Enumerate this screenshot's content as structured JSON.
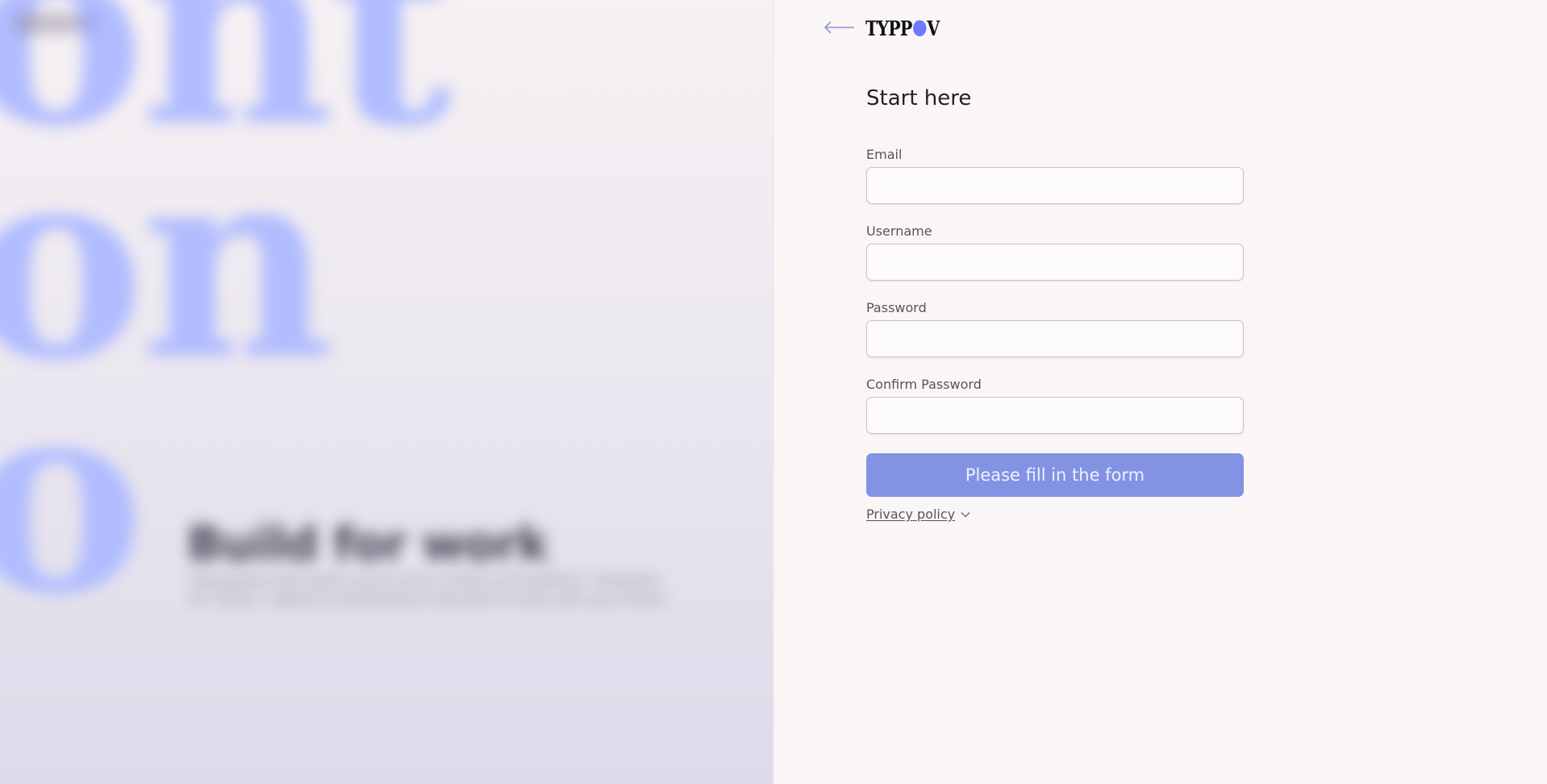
{
  "background_panel": {
    "big_glyphs": "ont\non\no",
    "heading": "Build for work",
    "body": "Typography that works across every surface and platform. Designed for clarity, crafted for performance and built to scale with your brand."
  },
  "header": {
    "back_icon": "arrow-left-icon",
    "brand_prefix": "TYPP",
    "brand_suffix": "V"
  },
  "form": {
    "title": "Start here",
    "fields": [
      {
        "label": "Email",
        "value": ""
      },
      {
        "label": "Username",
        "value": ""
      },
      {
        "label": "Password",
        "value": ""
      },
      {
        "label": "Confirm Password",
        "value": ""
      }
    ],
    "submit_label": "Please fill in the form",
    "privacy_label": "Privacy policy"
  },
  "colors": {
    "accent": "#6b7bff",
    "button": "#8293e4",
    "glyphs": "#b1bcff"
  }
}
